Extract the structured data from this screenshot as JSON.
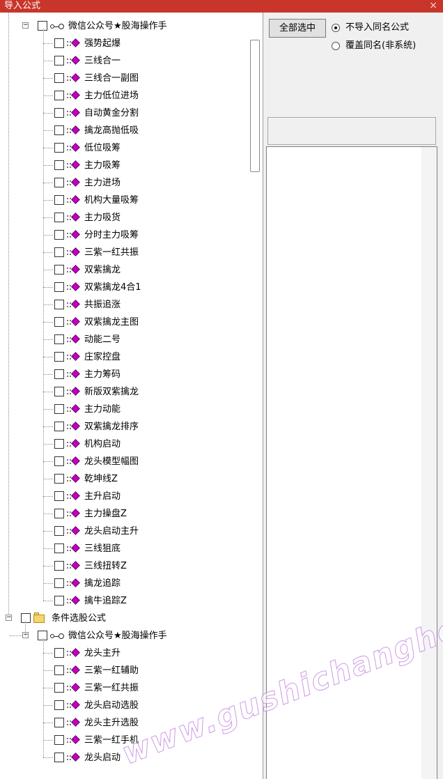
{
  "window": {
    "title": "导入公式",
    "close_glyph": "×"
  },
  "tree": {
    "group1": {
      "node_label": "微信公众号★股海操作手",
      "items": [
        "强势起爆",
        "三线合一",
        "三线合一副图",
        "主力低位进场",
        "自动黄金分割",
        "擒龙高抛低吸",
        "低位吸筹",
        "主力吸筹",
        "主力进场",
        "机构大量吸筹",
        "主力吸货",
        "分时主力吸筹",
        "三紫一红共振",
        "双紫擒龙",
        "双紫擒龙4合1",
        "共振追涨",
        "双紫擒龙主图",
        "动能二号",
        "庄家控盘",
        "主力筹码",
        "新版双紫擒龙",
        "主力动能",
        "双紫擒龙排序",
        "机构启动",
        "龙头模型幅图",
        "乾坤线Z",
        "主升启动",
        "主力操盘Z",
        "龙头启动主升",
        "三线狙底",
        "三线扭转Z",
        "擒龙追踪",
        "擒牛追踪Z"
      ]
    },
    "category2": {
      "label": "条件选股公式",
      "node_label": "微信公众号★股海操作手",
      "items": [
        "龙头主升",
        "三紫一红辅助",
        "三紫一红共振",
        "龙头启动选股",
        "龙头主升选股",
        "三紫一红手机",
        "龙头启动"
      ]
    }
  },
  "right_panel": {
    "select_all_label": "全部选中",
    "radio_options": [
      {
        "label": "不导入同名公式",
        "selected": true
      },
      {
        "label": "覆盖同名(非系统)",
        "selected": false
      }
    ]
  },
  "watermark": "www.gushichanghong.com",
  "colors": {
    "titlebar": "#c8352b",
    "formula_gem": "#c000c0",
    "folder": "#f5d66b"
  }
}
